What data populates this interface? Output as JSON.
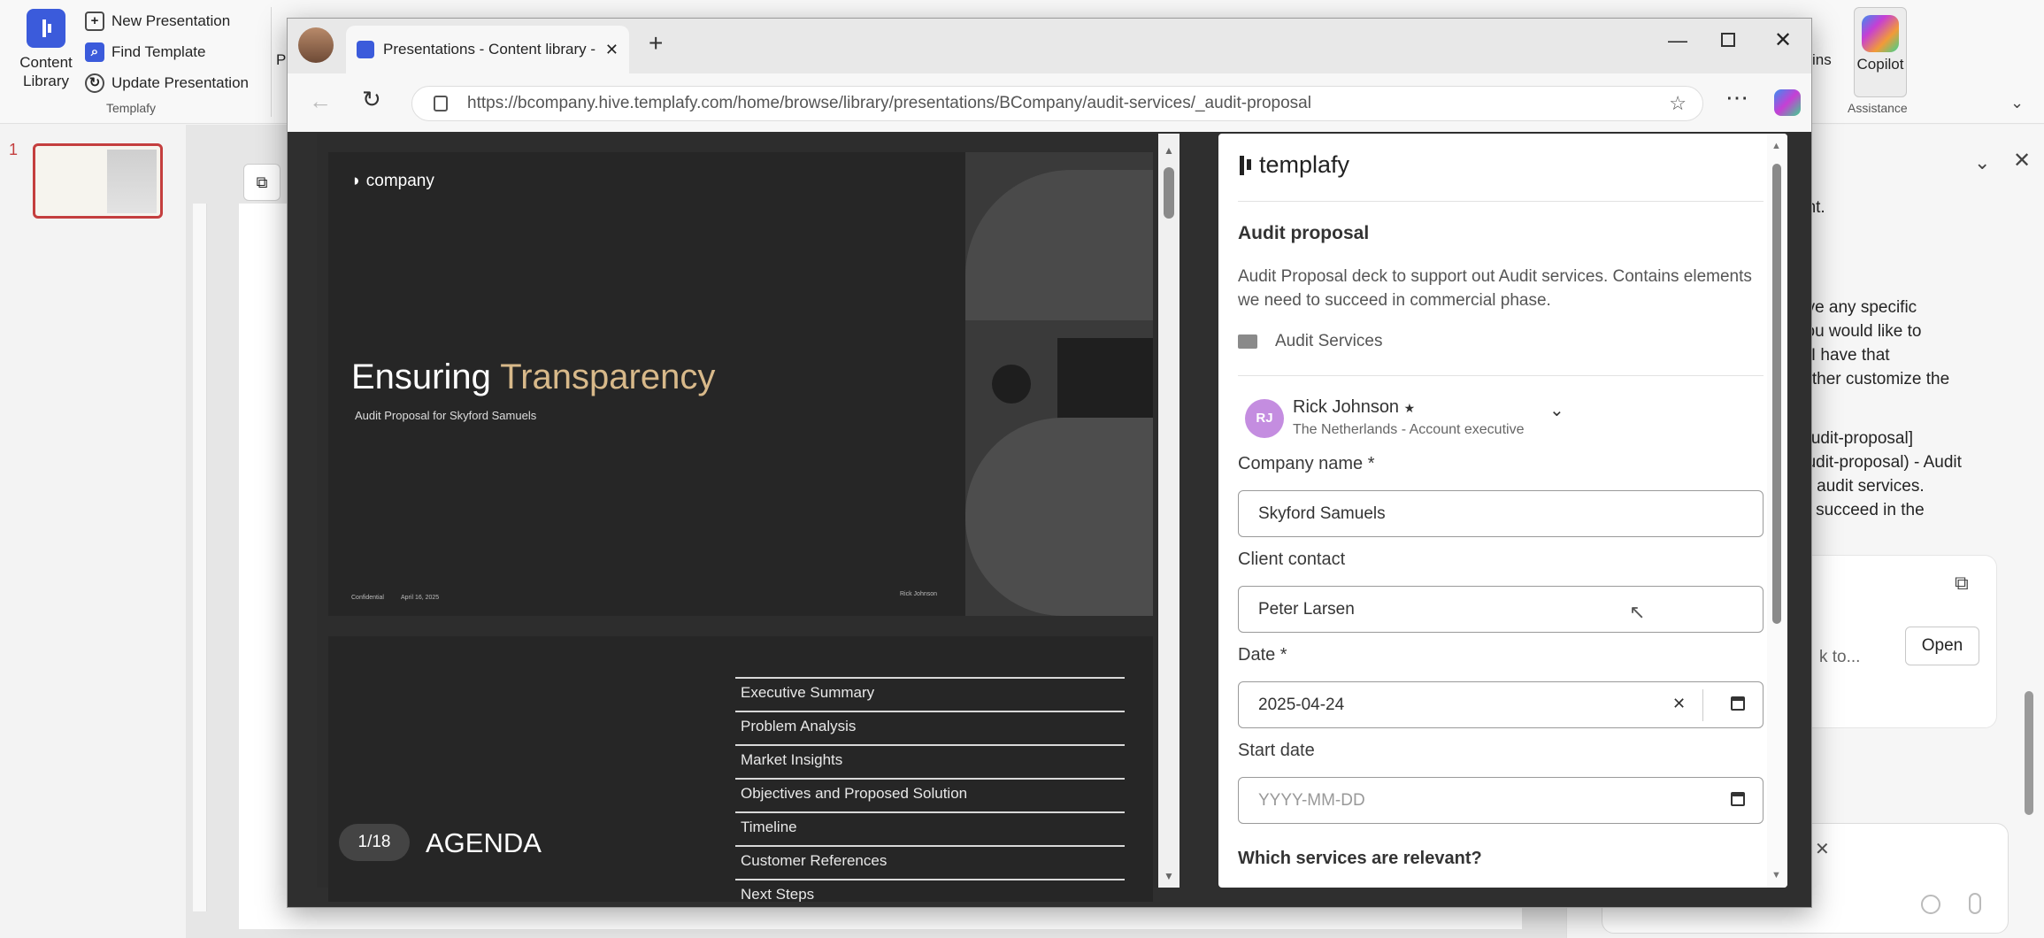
{
  "ribbon": {
    "content_library": "Content Library",
    "new_presentation": "New Presentation",
    "find_template": "Find Template",
    "update_presentation": "Update Presentation",
    "group_templafy": "Templafy",
    "copilot": "Copilot",
    "group_assistance": "Assistance",
    "partial_pa": "Pa",
    "partial_ins": "ins"
  },
  "slides_panel": {
    "slide_number": "1"
  },
  "browser": {
    "tab_title": "Presentations - Content library - T",
    "url": "https://bcompany.hive.templafy.com/home/browse/library/presentations/BCompany/audit-services/_audit-proposal"
  },
  "preview": {
    "slide1": {
      "logo": "company",
      "title_a": "Ensuring ",
      "title_b": "Transparency",
      "subtitle": "Audit Proposal for Skyford Samuels",
      "footer_left": "Confidential",
      "footer_date": "April 16, 2025",
      "footer_right": "Rick Johnson"
    },
    "slide2": {
      "counter": "1/18",
      "title": "AGENDA",
      "items": [
        "Executive Summary",
        "Problem Analysis",
        "Market Insights",
        "Objectives and Proposed Solution",
        "Timeline",
        "Customer References",
        "Next Steps"
      ]
    }
  },
  "panel": {
    "brand": "templafy",
    "title": "Audit proposal",
    "description": "Audit Proposal deck to support out Audit services. Contains elements we need to succeed in commercial phase.",
    "folder": "Audit Services",
    "user": {
      "initials": "RJ",
      "name": "Rick Johnson",
      "subtitle": "The Netherlands - Account executive"
    },
    "company_label": "Company name *",
    "company_value": "Skyford Samuels",
    "contact_label": "Client contact",
    "contact_value": "Peter Larsen",
    "date_label": "Date *",
    "date_value": "2025-04-24",
    "start_label": "Start date",
    "start_placeholder": "YYYY-MM-DD",
    "services_label": "Which services are relevant?"
  },
  "chat": {
    "lines": [
      "unt.",
      "ave any specific",
      "you would like to",
      "e I have that",
      "urther customize the",
      "/audit-proposal]",
      "audit-proposal) - Audit",
      "ur audit services.",
      "to succeed in the"
    ],
    "card_text": "k to...",
    "open": "Open"
  }
}
